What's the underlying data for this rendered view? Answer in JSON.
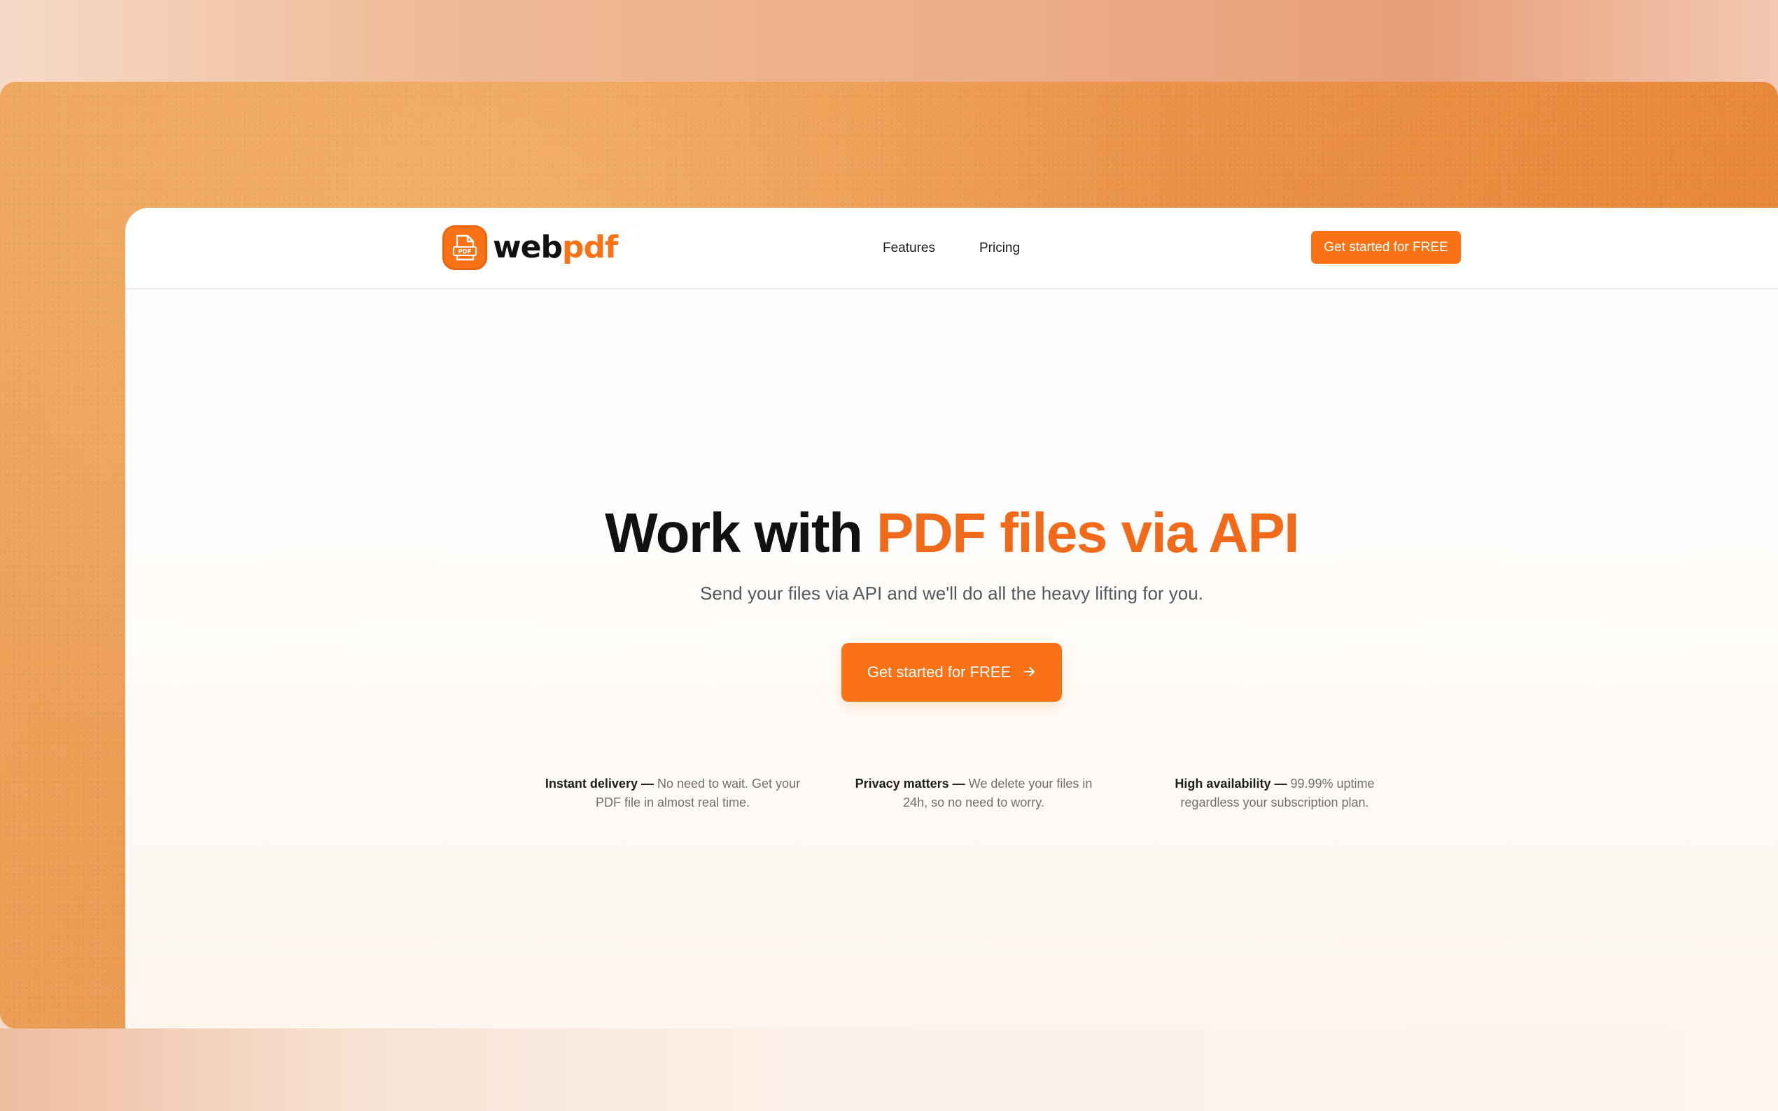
{
  "brand": {
    "name_part1": "web",
    "name_part2": "pdf",
    "icon": "pdf-file-icon",
    "icon_text": "PDF",
    "accent_color": "#f97316"
  },
  "nav": {
    "links": [
      "Features",
      "Pricing"
    ],
    "cta_label": "Get started for FREE"
  },
  "hero": {
    "title_plain": "Work with ",
    "title_accent": "PDF files via API",
    "subtitle": "Send your files via API and we'll do all the heavy lifting for you.",
    "cta_label": "Get started for FREE",
    "cta_icon": "arrow-right-icon"
  },
  "features": [
    {
      "title": "Instant delivery",
      "separator": " — ",
      "text": "No need to wait. Get your PDF file in almost real time."
    },
    {
      "title": "Privacy matters",
      "separator": " — ",
      "text": "We delete your files in 24h, so no need to worry."
    },
    {
      "title": "High availability",
      "separator": " — ",
      "text": "99.99% uptime regardless your subscription plan."
    }
  ]
}
